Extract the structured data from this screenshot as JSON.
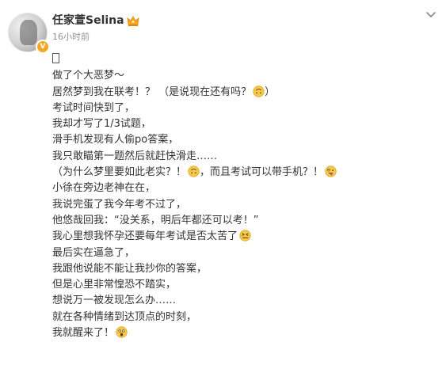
{
  "post": {
    "username": "任家萱Selina",
    "timestamp": "16小时前",
    "lines": [
      {
        "text": "",
        "emoji": "tofu"
      },
      {
        "text": "做了个大恶梦～",
        "emoji": ""
      },
      {
        "text": "居然梦到我在联考！？ （是说现在还有吗？",
        "emoji": "upside-down-face",
        "after": "）"
      },
      {
        "text": "考试时间快到了，",
        "emoji": ""
      },
      {
        "text": "我却才写了1/3试题，",
        "emoji": ""
      },
      {
        "text": "滑手机发现有人偷po答案，",
        "emoji": ""
      },
      {
        "text": "我只敢瞄第一题然后就赶快滑走……",
        "emoji": ""
      },
      {
        "text": "（为什么梦里要如此老实？！",
        "emoji": "upside-down-face",
        "after": "，而且考试可以带手机？！",
        "emoji2": "zany-face"
      },
      {
        "text": "小徐在旁边老神在在，",
        "emoji": ""
      },
      {
        "text": "我说完蛋了我今年考不过了，",
        "emoji": ""
      },
      {
        "text": "他悠哉回我：“没关系，明后年都还可以考！”",
        "emoji": ""
      },
      {
        "text": "我心里想我怀孕还要每年考试是否太苦了",
        "emoji": "confounded-face"
      },
      {
        "text": "最后实在逼急了，",
        "emoji": ""
      },
      {
        "text": "我跟他说能不能让我抄你的答案，",
        "emoji": ""
      },
      {
        "text": "但是心里非常惶恐不踏实，",
        "emoji": ""
      },
      {
        "text": "想说万一被发现怎么办……",
        "emoji": ""
      },
      {
        "text": "就在各种情绪到达顶点的时刻，",
        "emoji": ""
      },
      {
        "text": "我就醒来了！",
        "emoji": "screaming-face"
      }
    ]
  },
  "icons": {
    "avatar": "avatar",
    "verified": "verified-badge-icon",
    "crown": "crown-icon",
    "more": "chevron-down-icon"
  },
  "colors": {
    "text": "#333333",
    "timestamp": "#939393",
    "emoji_face": "#f7c948",
    "badge": "#f5a623"
  }
}
